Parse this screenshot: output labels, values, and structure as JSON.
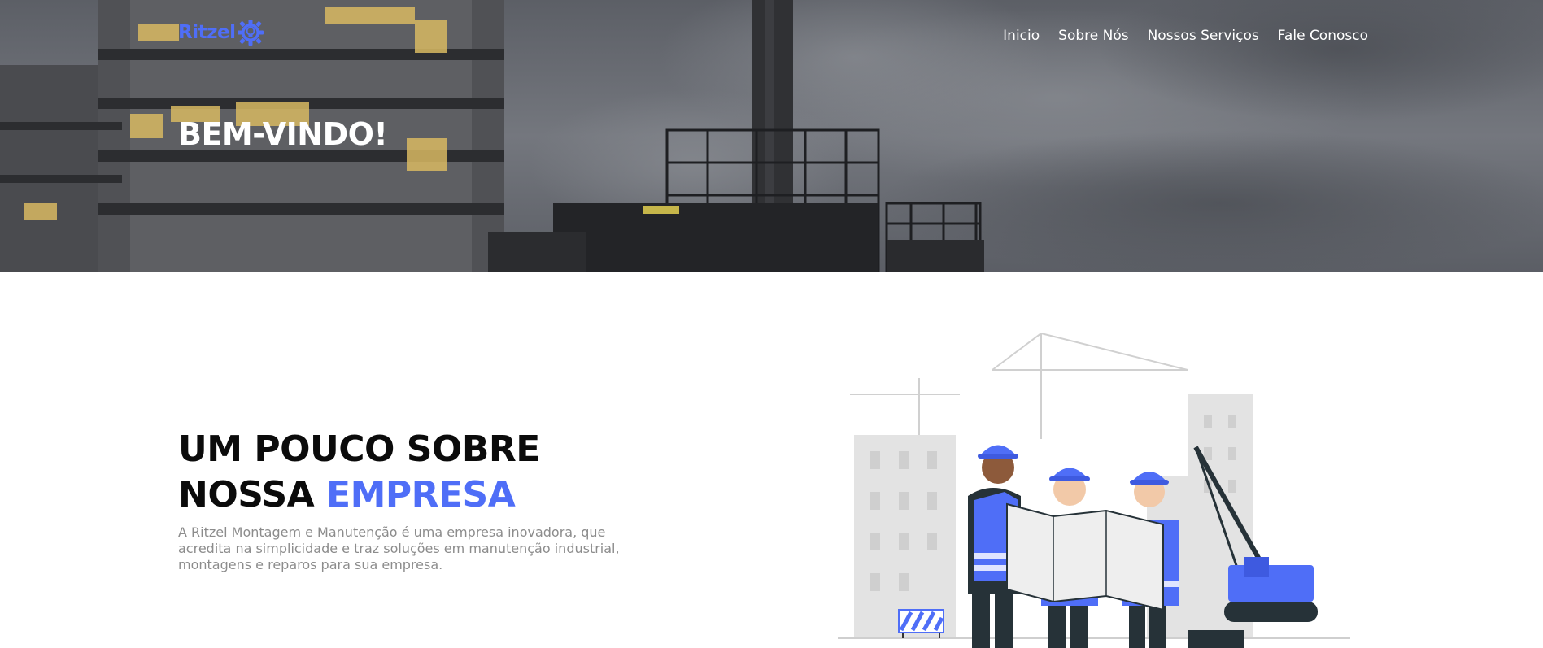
{
  "brand": {
    "logo_text": "Ritzel",
    "logo_icon": "gear-bulb-icon",
    "accent_color": "#4f6ef7"
  },
  "nav": {
    "items": [
      {
        "label": "Inicio"
      },
      {
        "label": "Sobre Nós"
      },
      {
        "label": "Nossos Serviços"
      },
      {
        "label": "Fale Conosco"
      }
    ]
  },
  "hero": {
    "title": "BEM-VINDO!"
  },
  "about": {
    "heading_line1": "UM POUCO SOBRE",
    "heading_line2_prefix": "NOSSA",
    "heading_line2_accent": "EMPRESA",
    "text": "A Ritzel Montagem e Manutenção é uma empresa inovadora, que acredita na simplicidade e traz soluções em manutenção industrial, montagens e reparos para sua empresa."
  }
}
